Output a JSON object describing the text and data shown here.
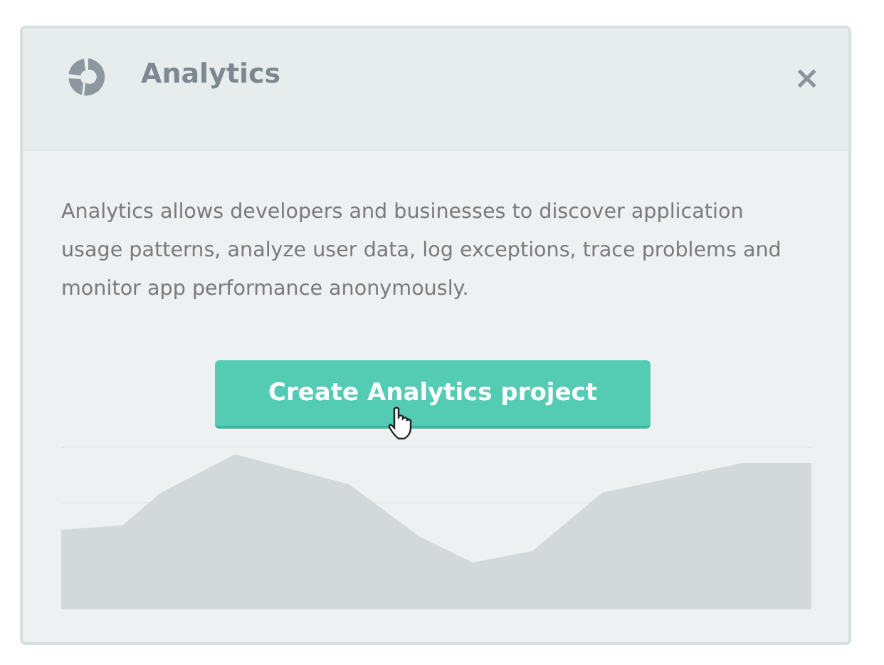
{
  "card": {
    "title": "Analytics",
    "description": "Analytics allows developers and businesses to discover application usage patterns, analyze user data, log exceptions, trace problems and monitor app performance anonymously.",
    "button": "Create Analytics project",
    "close": "×"
  }
}
